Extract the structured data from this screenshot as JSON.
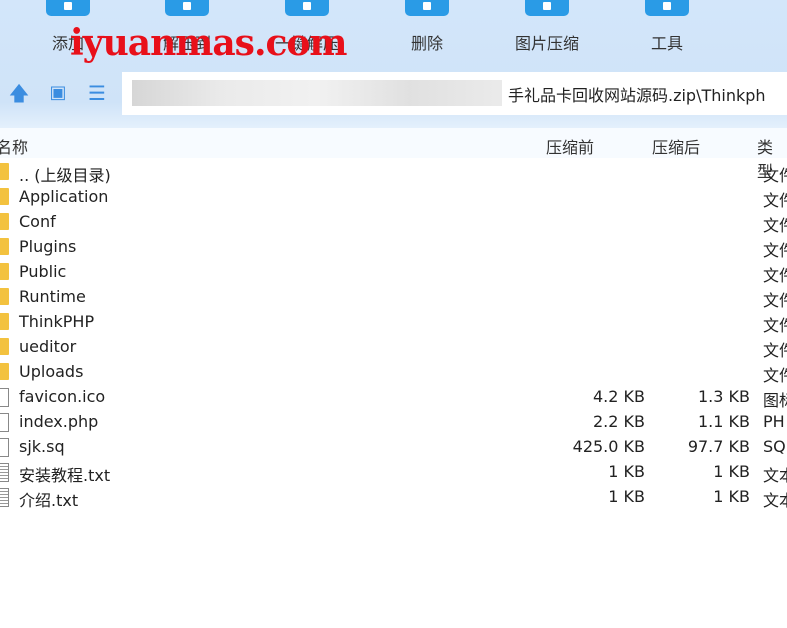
{
  "toolbar": {
    "buttons": [
      {
        "label": "添加",
        "icon": "add-icon"
      },
      {
        "label": "解压到",
        "icon": "extract-icon"
      },
      {
        "label": "一键解压",
        "icon": "one-click-extract-icon"
      },
      {
        "label": "删除",
        "icon": "delete-icon"
      },
      {
        "label": "图片压缩",
        "icon": "image-compress-icon"
      },
      {
        "label": "工具",
        "icon": "tools-icon"
      }
    ]
  },
  "watermark": "iyuanmas.com",
  "address": {
    "path_visible": "手礼品卡回收网站源码.zip\\Thinkph"
  },
  "columns": {
    "name": "名称",
    "before": "压缩前",
    "after": "压缩后",
    "type": "类型"
  },
  "rows": [
    {
      "name": ".. (上级目录)",
      "before": "",
      "after": "",
      "type": "文件",
      "kind": "folder"
    },
    {
      "name": "Application",
      "before": "",
      "after": "",
      "type": "文件",
      "kind": "folder"
    },
    {
      "name": "Conf",
      "before": "",
      "after": "",
      "type": "文件",
      "kind": "folder"
    },
    {
      "name": "Plugins",
      "before": "",
      "after": "",
      "type": "文件",
      "kind": "folder"
    },
    {
      "name": "Public",
      "before": "",
      "after": "",
      "type": "文件",
      "kind": "folder"
    },
    {
      "name": "Runtime",
      "before": "",
      "after": "",
      "type": "文件",
      "kind": "folder"
    },
    {
      "name": "ThinkPHP",
      "before": "",
      "after": "",
      "type": "文件",
      "kind": "folder"
    },
    {
      "name": "ueditor",
      "before": "",
      "after": "",
      "type": "文件",
      "kind": "folder"
    },
    {
      "name": "Uploads",
      "before": "",
      "after": "",
      "type": "文件",
      "kind": "folder"
    },
    {
      "name": "favicon.ico",
      "before": "4.2 KB",
      "after": "1.3 KB",
      "type": "图标",
      "kind": "file"
    },
    {
      "name": "index.php",
      "before": "2.2 KB",
      "after": "1.1 KB",
      "type": "PH",
      "kind": "file"
    },
    {
      "name": "sjk.sq",
      "before": "425.0 KB",
      "after": "97.7 KB",
      "type": "SQ",
      "kind": "file"
    },
    {
      "name": "安装教程.txt",
      "before": "1 KB",
      "after": "1 KB",
      "type": "文本",
      "kind": "txt"
    },
    {
      "name": "介绍.txt",
      "before": "1 KB",
      "after": "1 KB",
      "type": "文本",
      "kind": "txt"
    }
  ]
}
